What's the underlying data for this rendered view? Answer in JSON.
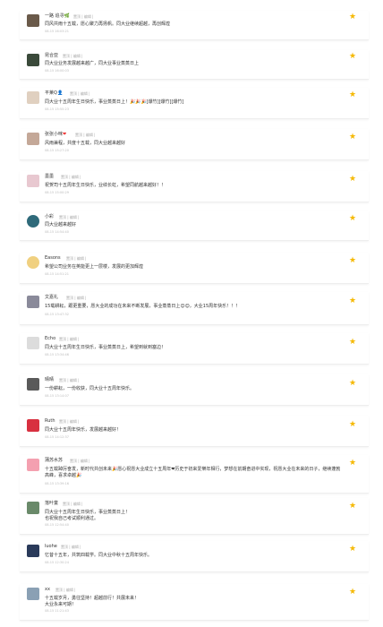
{
  "meta_links": "置顶 | 编辑 |",
  "accent_color": "#f5b800",
  "comments": [
    {
      "name": "一路 追寻",
      "name_suffix": "🌿",
      "time": "08-15 16:03:21",
      "text": "同风共雨十五载，愿心聚力再扬帆。同大业继续超越，再创辉煌",
      "lines": 1
    },
    {
      "name": "昆合亚",
      "time": "08-15 16:00:03",
      "text": "同大业业务发展越来越广，同大业事业蒸蒸日上",
      "lines": 1
    },
    {
      "name": "平莱Q",
      "name_suffix": "👤",
      "time": "08-15 15:55:23",
      "text": "同大业十五周年生日快乐，事业蒸蒸日上！🎉🎉🎉[爆竹][爆竹][爆竹]",
      "lines": 1
    },
    {
      "name": "张张小咪",
      "name_suffix": "❤",
      "time": "08-15 15:27:20",
      "text": "风雨兼程，共度十五载，同大业越来越好",
      "lines": 1
    },
    {
      "name": "墨墨",
      "time": "08-15 15:00:29",
      "text": "祝贺司十五周年生日快乐，业绩长虹，希望同航越来越好！！",
      "lines": 1
    },
    {
      "name": "小彩",
      "time": "08-15 14:54:40",
      "text": "同大业越来越好",
      "lines": 1
    },
    {
      "name": "Easons",
      "time": "08-15 14:51:21",
      "text": "希望公司业务在英能更上一层楼，发展的更加辉煌",
      "lines": 1
    },
    {
      "name": "文嘉礼",
      "time": "08-15 13:47:32",
      "text": "15载耕耘，跟更重要，愿大业的成功在未来不断发展，事业蒸蒸日上😊😊，大业15周年快乐！！！",
      "lines": 1
    },
    {
      "name": "Echo",
      "time": "08-15 13:34:46",
      "text": "同大业十五周年生日快乐，事业蒸蒸日上，希望到就到塞边！",
      "lines": 1
    },
    {
      "name": "晴晴",
      "time": "08-15 13:14:07",
      "text": "一份耕耘，一份收获，同大业十五周年快乐。",
      "lines": 1
    },
    {
      "name": "Ruth",
      "time": "08-15 14:12:37",
      "text": "同大业十五周年快乐，发展越来越好！",
      "lines": 1
    },
    {
      "name": "蒲苏水苏",
      "time": "08-15 13:39:16",
      "text": "十五载踔厉奋发，新时代共创未来🎉愿心祝愿大业成立十五周年❤历史于初来爱樂年相行，梦想在前期奋进中实现，祝愿大业在未来的日子，继续蓬勃高峰，喜求卓越🎉",
      "lines": 2
    },
    {
      "name": "落叶童",
      "time": "08-15 12:54:40",
      "text": "同大业十五周年生日快乐，事业蒸蒸日上！\n也祝我自己考试顺利通过。",
      "lines": 2
    },
    {
      "name": "luohe",
      "time": "08-15 12:30:24",
      "text": "忆昔十五年，共筑四载学。同大业中秋十五周年快乐。",
      "lines": 1
    },
    {
      "name": "xx",
      "time": "08-15 11:21:43",
      "text": "十五载岁月，勇往坚持！超越前行！共展未来！\n大业永来可期！",
      "lines": 2
    }
  ]
}
